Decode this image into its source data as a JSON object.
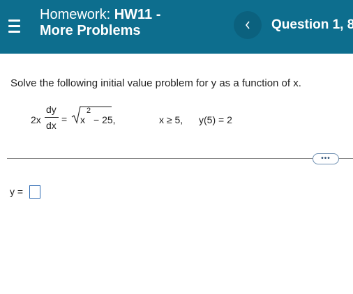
{
  "header": {
    "hw_prefix": "Homework:",
    "hw_name": "HW11 -",
    "hw_subtitle": "More Problems",
    "question_label": "Question 1, 8"
  },
  "problem": {
    "prompt": "Solve the following initial value problem for y as a function of x.",
    "lhs_coef": "2x",
    "deriv_num": "dy",
    "deriv_den": "dx",
    "equals": "=",
    "radicand": "x",
    "exponent": "2",
    "radicand_rest": "− 25,",
    "condition": "x ≥ 5,",
    "initial": "y(5) = 2"
  },
  "toolbar": {
    "more_label": "•••"
  },
  "answer": {
    "label": "y =",
    "value": ""
  },
  "colors": {
    "header_bg": "#0d6e8e",
    "answer_border": "#2f6bb3"
  },
  "icons": {
    "menu": "hamburger-icon",
    "prev": "chevron-left-icon"
  }
}
